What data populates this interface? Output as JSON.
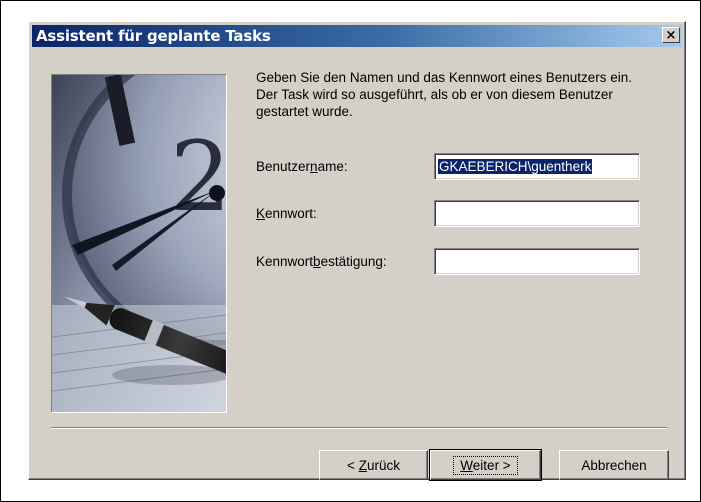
{
  "window": {
    "title": "Assistent für geplante Tasks",
    "close_glyph": "×"
  },
  "intro_text": "Geben Sie den Namen und das Kennwort eines Benutzers ein. Der Task wird so ausgeführt, als ob er von diesem Benutzer gestartet wurde.",
  "fields": {
    "username": {
      "label_pre": "Benutzer",
      "label_accel": "n",
      "label_post": "ame:",
      "value": "GKAEBERICH\\guentherk"
    },
    "password": {
      "label_pre": "",
      "label_accel": "K",
      "label_post": "ennwort:",
      "value": ""
    },
    "confirm": {
      "label_pre": "Kennwort",
      "label_accel": "b",
      "label_post": "estätigung:",
      "value": ""
    }
  },
  "buttons": {
    "back": {
      "pre": "< ",
      "accel": "Z",
      "post": "urück"
    },
    "next": {
      "pre": "",
      "accel": "W",
      "post": "eiter >"
    },
    "cancel": {
      "label": "Abbrechen"
    }
  },
  "colors": {
    "dialog_bg": "#d4d0c8",
    "title_start": "#0a246a",
    "title_end": "#a6caf0",
    "selection": "#0a246a"
  },
  "icons": {
    "close": "close-icon",
    "artwork": "clock-and-pen-artwork"
  }
}
